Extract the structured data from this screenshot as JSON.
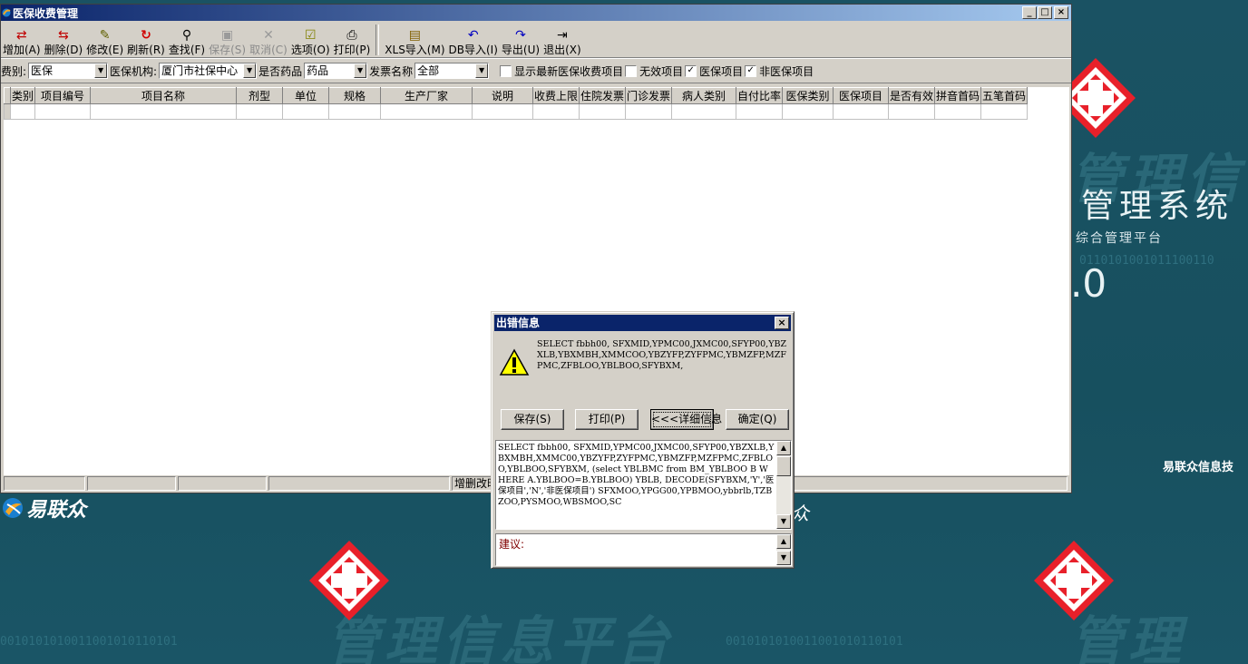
{
  "window": {
    "title": "医保收费管理",
    "btn_min": "_",
    "btn_max": "□",
    "btn_close": "×"
  },
  "toolbar": {
    "items": [
      {
        "label": "增加(A)",
        "icon": "add-icon",
        "enabled": true
      },
      {
        "label": "删除(D)",
        "icon": "delete-icon",
        "enabled": true
      },
      {
        "label": "修改(E)",
        "icon": "edit-icon",
        "enabled": true
      },
      {
        "label": "刷新(R)",
        "icon": "refresh-icon",
        "enabled": true
      },
      {
        "label": "查找(F)",
        "icon": "binoculars-icon",
        "enabled": true
      },
      {
        "label": "保存(S)",
        "icon": "floppy-icon",
        "enabled": false
      },
      {
        "label": "取消(C)",
        "icon": "cancel-icon",
        "enabled": false
      },
      {
        "label": "选项(O)",
        "icon": "options-icon",
        "enabled": true
      },
      {
        "label": "打印(P)",
        "icon": "printer-icon",
        "enabled": true
      },
      {
        "label": "XLS导入(M)",
        "icon": "xls-import-icon",
        "enabled": true
      },
      {
        "label": "DB导入(I)",
        "icon": "db-import-icon",
        "enabled": true
      },
      {
        "label": "导出(U)",
        "icon": "export-icon",
        "enabled": true
      },
      {
        "label": "退出(X)",
        "icon": "exit-icon",
        "enabled": true
      }
    ]
  },
  "filter": {
    "fee_type_label": "费别:",
    "fee_type_value": "医保",
    "institution_label": "医保机构:",
    "institution_value": "厦门市社保中心",
    "is_drug_label": "是否药品",
    "is_drug_value": "药品",
    "invoice_label": "发票名称",
    "invoice_value": "全部",
    "checkboxes": [
      {
        "label": "显示最新医保收费项目",
        "checked": false
      },
      {
        "label": "无效项目",
        "checked": false
      },
      {
        "label": "医保项目",
        "checked": true
      },
      {
        "label": "非医保项目",
        "checked": true
      }
    ]
  },
  "grid": {
    "columns": [
      "类别",
      "项目编号",
      "项目名称",
      "剂型",
      "单位",
      "规格",
      "生产厂家",
      "说明",
      "收费上限",
      "住院发票",
      "门诊发票",
      "病人类别",
      "自付比率",
      "医保类别",
      "医保项目",
      "是否有效",
      "拼音首码",
      "五笔首码"
    ]
  },
  "statusbar": {
    "mode_text": "增删改时"
  },
  "dialog": {
    "title": "出错信息",
    "close": "×",
    "message": "SELECT fbbh00, SFXMID,YPMC00,JXMC00,SFYP00,YBZXLB,YBXMBH,XMMCOO,YBZYFP,ZYFPMC,YBMZFP,MZFPMC,ZFBLOO,YBLBOO,SFYBXM,",
    "buttons": {
      "save": "保存(S)",
      "print": "打印(P)",
      "detail": "<<<详细信息",
      "ok": "确定(Q)"
    },
    "detail_text": "SELECT fbbh00, SFXMID,YPMC00,JXMC00,SFYP00,YBZXLB,YBXMBH,XMMC00,YBZYFP,ZYFPMC,YBMZFP,MZFPMC,ZFBLOO,YBLBOO,SFYBXM, (select YBLBMC from BM_YBLBOO B WHERE A.YBLBOO=B.YBLBOO) YBLB, DECODE(SFYBXM,'Y','医保项目','N','非医保项目') SFXMOO,YPGG00,YPBMOO,ybbrlb,TZBZOO,PYSMOO,WBSMOO,SC",
    "suggestion_label": "建议:"
  },
  "desktop": {
    "system_title": "管理系统",
    "system_subtitle": "综合管理平台",
    "version": ".0",
    "company": "易联众信息技",
    "logo_text": "易联众",
    "logo_text2": "众"
  },
  "colors": {
    "titlebar_start": "#0a246a",
    "titlebar_end": "#a6caf0",
    "window_face": "#d4d0c8",
    "desktop_bg": "#1a5263",
    "cross_red": "#e8202a"
  }
}
